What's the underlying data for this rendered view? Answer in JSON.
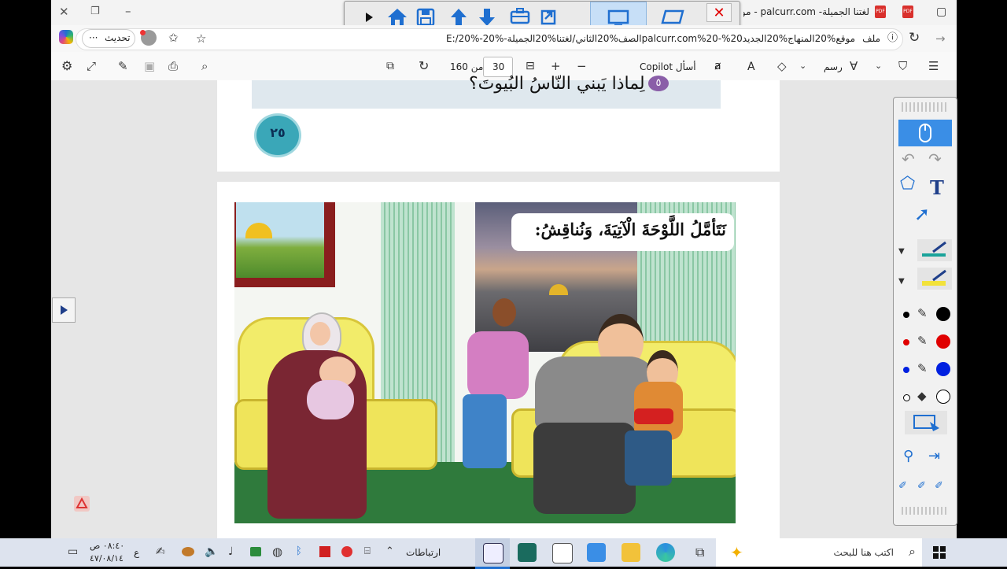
{
  "window": {
    "tab_title": "لغتنا الجميلة- palcurr.com - موقع",
    "pdf_label": "PDF"
  },
  "address_bar": {
    "file_label": "ملف",
    "url": "E:/20%-الصف%20الثاني/لغتنا%20الجميلة-%20palcurr.com%20-%20موقع%20المنهاج%20الجديد.pdf",
    "update_label": "تحديث",
    "more_label": "···"
  },
  "pdf_toolbar": {
    "page_current": "30",
    "page_of": "من 160",
    "copilot_label": "Copilot أسأل",
    "draw_label": "رسم",
    "read_aloud": "A"
  },
  "page_top": {
    "question_number": "٥",
    "question_text": "لِماذا يَبني النّاسُ البُيوتَ؟",
    "page_number": "٢٥"
  },
  "page_main": {
    "instruction": "نَتَأمَّلُ اللَّوْحَةَ الْآتِيَةَ، وَنُناقِشُ:"
  },
  "colors": {
    "accent_blue": "#1f6fd0",
    "page_badge": "#3aa7b8",
    "taskbar": "#dde3ee"
  },
  "pen_toolbar": {
    "colors": [
      "#000000",
      "#e00000",
      "#0020e0",
      "#ffffff"
    ],
    "text_tool": "T"
  },
  "taskbar": {
    "search_placeholder": "اكتب هنا للبحث",
    "links_label": "ارتباطات",
    "time": "٠٨:٤٠ ص",
    "date": "٤٧/٠٨/١٤",
    "lang": "ع"
  }
}
